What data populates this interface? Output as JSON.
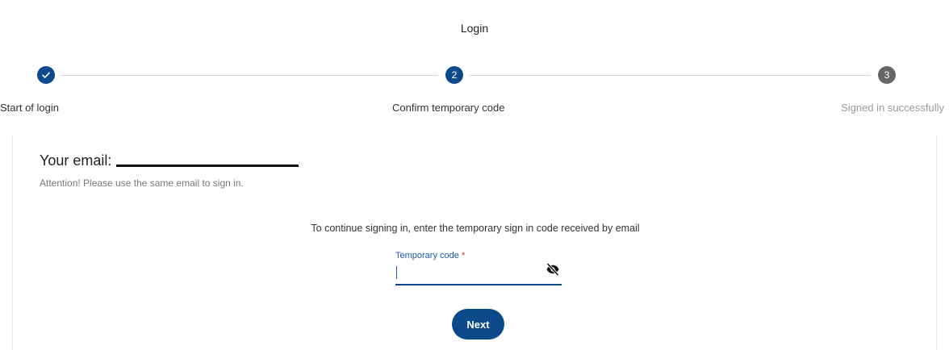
{
  "header": {
    "title": "Login"
  },
  "stepper": {
    "steps": [
      {
        "number": "1",
        "label": "Start of login",
        "state": "completed",
        "icon": "check-icon"
      },
      {
        "number": "2",
        "label": "Confirm temporary code",
        "state": "active"
      },
      {
        "number": "3",
        "label": "Signed in successfully",
        "state": "pending"
      }
    ]
  },
  "card": {
    "email_label": "Your email:",
    "attention": "Attention! Please use the same email to sign in.",
    "instruction": "To continue signing in, enter the temporary sign in code received by email",
    "code_field": {
      "label": "Temporary code",
      "required_mark": "*",
      "value": "",
      "toggle_icon": "eye-off-icon"
    },
    "next_label": "Next"
  },
  "colors": {
    "primary": "#0d4a8c",
    "pending": "#666666",
    "required": "#d93025"
  }
}
